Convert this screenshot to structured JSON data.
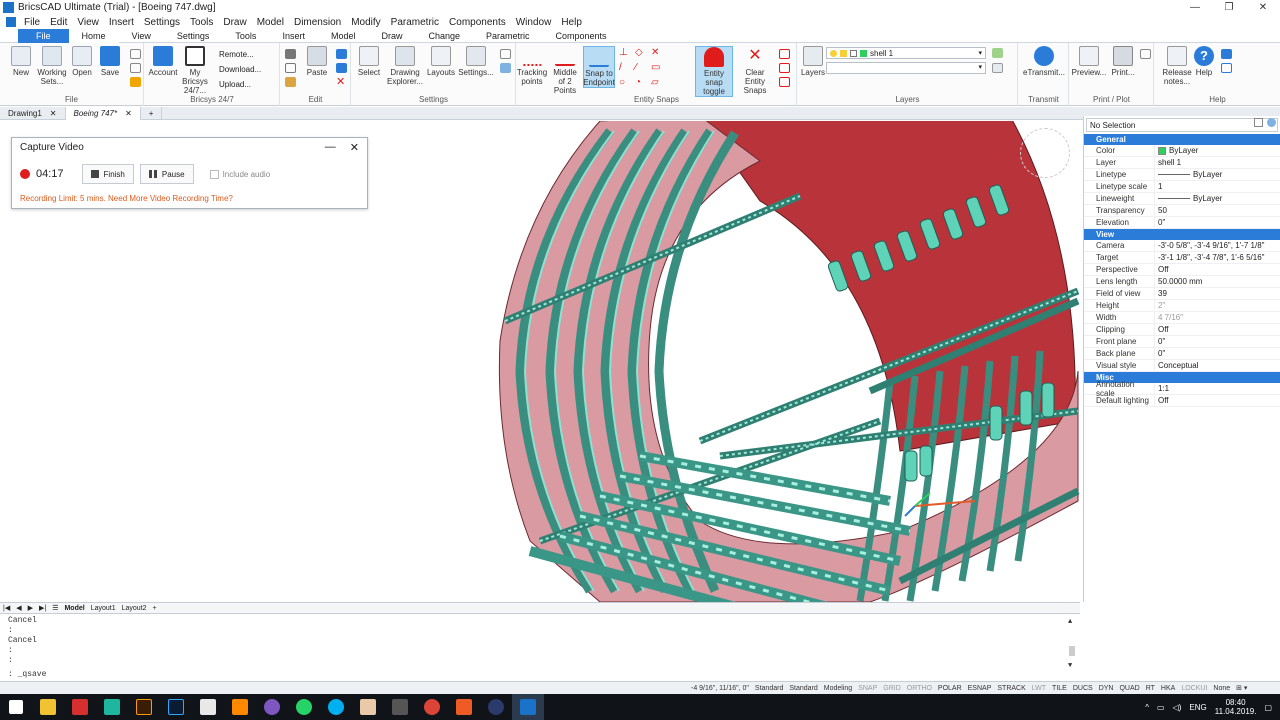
{
  "window": {
    "title": "BricsCAD Ultimate (Trial) - [Boeing 747.dwg]"
  },
  "menu": [
    "File",
    "Edit",
    "View",
    "Insert",
    "Settings",
    "Tools",
    "Draw",
    "Model",
    "Dimension",
    "Modify",
    "Parametric",
    "Components",
    "Window",
    "Help"
  ],
  "ribbon_tabs": [
    "File",
    "Home",
    "View",
    "Settings",
    "Tools",
    "Insert",
    "Model",
    "Draw",
    "Change",
    "Parametric",
    "Components"
  ],
  "ribbon": {
    "file": {
      "label": "File",
      "buttons": [
        "New",
        "Working Sets...",
        "Open",
        "Save"
      ]
    },
    "bricsys": {
      "label": "Bricsys 24/7",
      "buttons": [
        "Account",
        "My Bricsys 24/7..."
      ],
      "links": [
        "Remote...",
        "Download...",
        "Upload..."
      ]
    },
    "edit": {
      "label": "Edit",
      "buttons": [
        "Paste"
      ]
    },
    "settings": {
      "label": "Settings",
      "buttons": [
        "Select",
        "Drawing Explorer...",
        "Layouts",
        "Settings..."
      ]
    },
    "snaps": {
      "label": "Entity Snaps",
      "buttons": [
        "Tracking points",
        "Middle of 2 Points",
        "Snap to Endpoint",
        "Entity snap toggle",
        "Clear Entity Snaps"
      ]
    },
    "layers": {
      "label": "Layers",
      "buttons": [
        "Layers"
      ],
      "current_layer": "shell 1"
    },
    "transmit": {
      "label": "Transmit",
      "buttons": [
        "eTransmit..."
      ]
    },
    "print": {
      "label": "Print / Plot",
      "buttons": [
        "Preview...",
        "Print..."
      ]
    },
    "help": {
      "label": "Help",
      "buttons": [
        "Release notes...",
        "Help"
      ]
    }
  },
  "doc_tabs": [
    "Drawing1",
    "Boeing 747*"
  ],
  "capture": {
    "title": "Capture Video",
    "time": "04:17",
    "finish": "Finish",
    "pause": "Pause",
    "include_audio": "Include audio",
    "limit": "Recording Limit: 5 mins. Need More Video Recording Time?"
  },
  "properties": {
    "selection": "No Selection",
    "general": {
      "title": "General",
      "rows": [
        {
          "k": "Color",
          "v": "ByLayer"
        },
        {
          "k": "Layer",
          "v": "shell 1"
        },
        {
          "k": "Linetype",
          "v": "ByLayer"
        },
        {
          "k": "Linetype scale",
          "v": "1"
        },
        {
          "k": "Lineweight",
          "v": "ByLayer"
        },
        {
          "k": "Transparency",
          "v": "50"
        },
        {
          "k": "Elevation",
          "v": "0\""
        }
      ]
    },
    "view": {
      "title": "View",
      "rows": [
        {
          "k": "Camera",
          "v": "-3'-0 5/8\", -3'-4 9/16\", 1'-7 1/8\""
        },
        {
          "k": "Target",
          "v": "-3'-1 1/8\", -3'-4 7/8\", 1'-6 5/16\""
        },
        {
          "k": "Perspective",
          "v": "Off"
        },
        {
          "k": "Lens length",
          "v": "50.0000 mm"
        },
        {
          "k": "Field of view",
          "v": "39"
        },
        {
          "k": "Height",
          "v": "2\""
        },
        {
          "k": "Width",
          "v": "4 7/16\""
        },
        {
          "k": "Clipping",
          "v": "Off"
        },
        {
          "k": "Front plane",
          "v": "0\""
        },
        {
          "k": "Back plane",
          "v": "0\""
        },
        {
          "k": "Visual style",
          "v": "Conceptual"
        }
      ]
    },
    "misc": {
      "title": "Misc",
      "rows": [
        {
          "k": "Annotation scale",
          "v": "1:1"
        },
        {
          "k": "Default lighting",
          "v": "Off"
        }
      ]
    }
  },
  "layout_tabs": [
    "Model",
    "Layout1",
    "Layout2"
  ],
  "command": [
    "Cancel",
    ":",
    "Cancel",
    ":",
    ":"
  ],
  "command_prompt": ": _qsave",
  "status": {
    "coords": "-4 9/16\", 11/16\", 0\"",
    "items": [
      "Standard",
      "Standard",
      "Modeling",
      "SNAP",
      "GRID",
      "ORTHO",
      "POLAR",
      "ESNAP",
      "STRACK",
      "LWT",
      "TILE",
      "DUCS",
      "DYN",
      "QUAD",
      "RT",
      "HKA",
      "LOCKUI",
      "None"
    ]
  },
  "taskbar": {
    "lang": "ENG",
    "time": "08:40",
    "date": "11.04.2019."
  }
}
